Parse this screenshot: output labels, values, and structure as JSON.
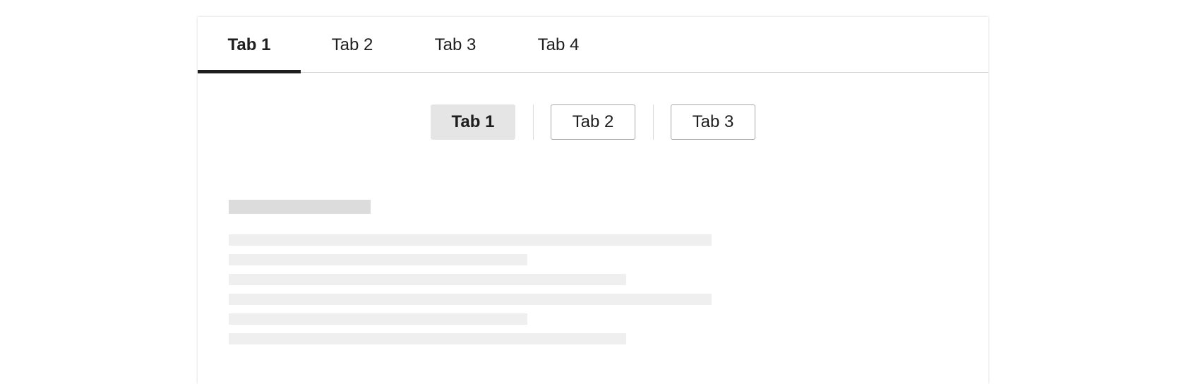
{
  "top_tabs": [
    {
      "label": "Tab 1",
      "active": true
    },
    {
      "label": "Tab 2",
      "active": false
    },
    {
      "label": "Tab 3",
      "active": false
    },
    {
      "label": "Tab 4",
      "active": false
    }
  ],
  "segmented_tabs": [
    {
      "label": "Tab 1",
      "active": true
    },
    {
      "label": "Tab 2",
      "active": false
    },
    {
      "label": "Tab 3",
      "active": false
    }
  ],
  "colors": {
    "accent": "#1e1e1e",
    "active_segment_bg": "#e5e5e5",
    "skeleton": "#efefef",
    "skeleton_title": "#dcdcdc"
  }
}
